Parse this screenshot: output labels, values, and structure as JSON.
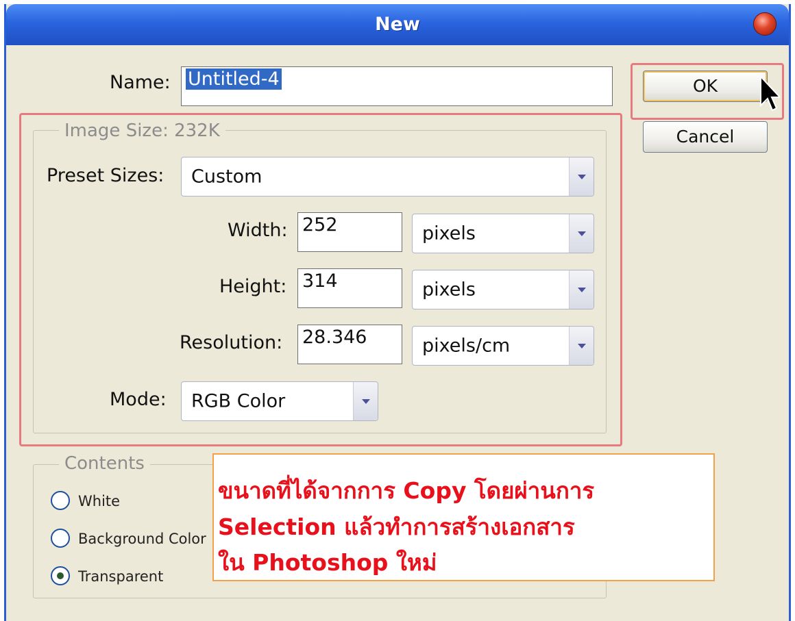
{
  "window": {
    "title": "New"
  },
  "name_field": {
    "label": "Name:",
    "value": "Untitled-4"
  },
  "buttons": {
    "ok": "OK",
    "cancel": "Cancel"
  },
  "image_size": {
    "group_title": "Image Size: 232K",
    "preset_label": "Preset Sizes:",
    "preset_value": "Custom",
    "width_label": "Width:",
    "width_value": "252",
    "width_unit": "pixels",
    "height_label": "Height:",
    "height_value": "314",
    "height_unit": "pixels",
    "resolution_label": "Resolution:",
    "resolution_value": "28.346",
    "resolution_unit": "pixels/cm",
    "mode_label": "Mode:",
    "mode_value": "RGB Color"
  },
  "contents": {
    "group_title": "Contents",
    "options": [
      {
        "label": "White",
        "checked": false
      },
      {
        "label": "Background Color",
        "checked": false
      },
      {
        "label": "Transparent",
        "checked": true
      }
    ]
  },
  "annotation": {
    "lines": [
      "ขนาดที่ได้จากการ Copy โดยผ่านการ",
      "Selection แล้วทำการสร้างเอกสาร",
      "ใน Photoshop ใหม่"
    ],
    "color": "#e8101a"
  },
  "colors": {
    "highlight_border": "#e77a80",
    "note_border": "#f4a048",
    "titlebar": "#2a64de"
  }
}
